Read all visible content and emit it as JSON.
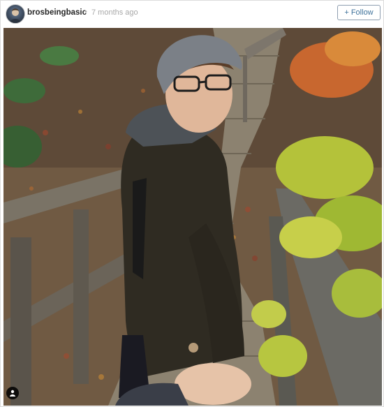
{
  "post": {
    "username": "brosbeingbasic",
    "separator": "•",
    "timestamp": "7 months ago",
    "follow_label": "+ Follow"
  },
  "icons": {
    "avatar": "avatar",
    "tagged_users": "user-icon"
  },
  "colors": {
    "follow_text": "#3f729b",
    "username": "#262626",
    "timestamp": "#a8a8a8"
  }
}
